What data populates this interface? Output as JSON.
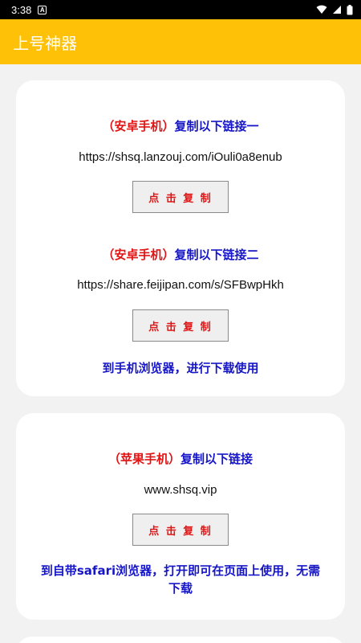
{
  "status_bar": {
    "time": "3:38",
    "notification_glyph": "A",
    "icons": [
      "wifi-icon",
      "signal-icon",
      "battery-icon"
    ]
  },
  "app_bar": {
    "title": "上号神器",
    "color": "#ffc107"
  },
  "card_android": {
    "section1": {
      "heading_red": "（安卓手机）",
      "heading_blue": "复制以下链接一",
      "link": "https://shsq.lanzouj.com/iOuli0a8enub",
      "button": "点 击 复 制"
    },
    "section2": {
      "heading_red": "（安卓手机）",
      "heading_blue": "复制以下链接二",
      "link": "https://share.feijipan.com/s/SFBwpHkh",
      "button": "点 击 复 制"
    },
    "note": "到手机浏览器，进行下载使用"
  },
  "card_ios": {
    "heading_red": "（苹果手机）",
    "heading_blue": "复制以下链接",
    "link": "www.shsq.vip",
    "button": "点 击 复 制",
    "note": "到自带safari浏览器，打开即可在页面上使用，无需下载"
  },
  "colors": {
    "accent": "#ffc107",
    "red_text": "#e01414",
    "blue_text": "#1616c8"
  }
}
